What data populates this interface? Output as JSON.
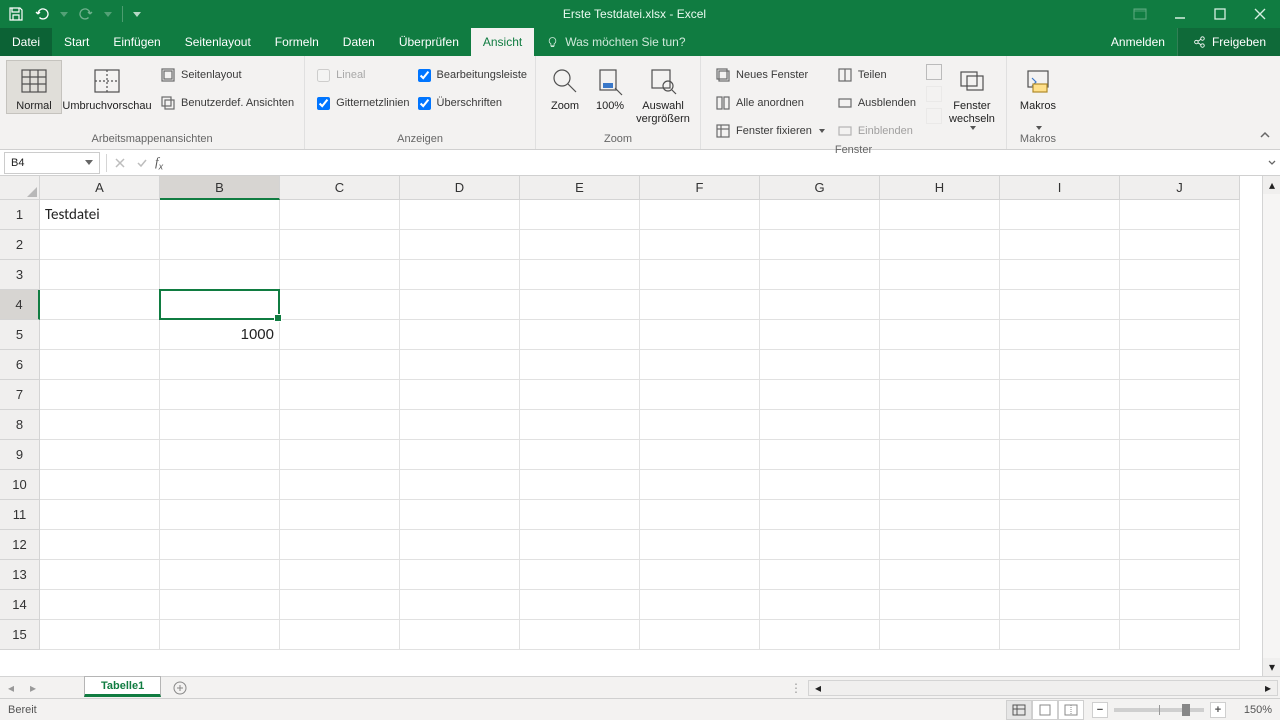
{
  "titlebar": {
    "title": "Erste Testdatei.xlsx - Excel"
  },
  "tabs": {
    "file": "Datei",
    "list": [
      "Start",
      "Einfügen",
      "Seitenlayout",
      "Formeln",
      "Daten",
      "Überprüfen",
      "Ansicht"
    ],
    "active_index": 6,
    "tellme_placeholder": "Was möchten Sie tun?",
    "login": "Anmelden",
    "share": "Freigeben"
  },
  "ribbon": {
    "views": {
      "normal": "Normal",
      "umbruch": "Umbruchvorschau",
      "seitenlayout": "Seitenlayout",
      "benutzerdef": "Benutzerdef. Ansichten",
      "group_label": "Arbeitsmappenansichten"
    },
    "anzeigen": {
      "lineal": "Lineal",
      "gitter": "Gitternetzlinien",
      "bearbeitung": "Bearbeitungsleiste",
      "ueberschriften": "Überschriften",
      "group_label": "Anzeigen"
    },
    "zoom": {
      "zoom": "Zoom",
      "hundred": "100%",
      "auswahl": "Auswahl vergrößern",
      "group_label": "Zoom"
    },
    "fenster": {
      "neues": "Neues Fenster",
      "alle": "Alle anordnen",
      "fixieren": "Fenster fixieren",
      "teilen": "Teilen",
      "ausblenden": "Ausblenden",
      "einblenden": "Einblenden",
      "wechseln": "Fenster wechseln",
      "group_label": "Fenster"
    },
    "makros": {
      "label": "Makros",
      "group_label": "Makros"
    }
  },
  "fxbar": {
    "namebox": "B4",
    "formula": ""
  },
  "grid": {
    "columns": [
      "A",
      "B",
      "C",
      "D",
      "E",
      "F",
      "G",
      "H",
      "I",
      "J"
    ],
    "rows": [
      1,
      2,
      3,
      4,
      5,
      6,
      7,
      8,
      9,
      10,
      11,
      12,
      13,
      14,
      15
    ],
    "selected_col_index": 1,
    "selected_row_index": 3,
    "cells": {
      "A1": "Testdatei",
      "B5": "1000"
    }
  },
  "sheettabs": {
    "active": "Tabelle1"
  },
  "status": {
    "ready": "Bereit",
    "zoom_pct": "150%"
  }
}
